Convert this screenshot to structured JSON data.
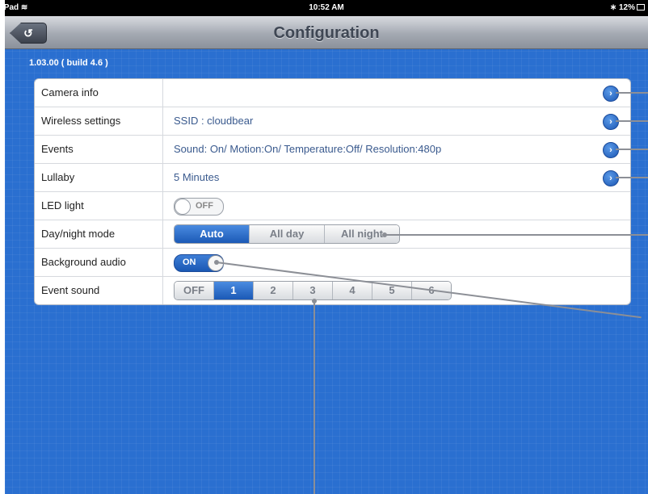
{
  "statusbar": {
    "device": "iPad",
    "wifi_icon": "wifi-icon",
    "time": "10:52 AM",
    "bluetooth_icon": "bluetooth-icon",
    "battery": "12%"
  },
  "navbar": {
    "back_icon": "back-arrow-icon",
    "back_glyph": "↺",
    "title": "Configuration"
  },
  "version": "1.03.00 ( build 4.6 )",
  "rows": [
    {
      "label": "Camera info",
      "value": ""
    },
    {
      "label": "Wireless settings",
      "value": "SSID : cloudbear"
    },
    {
      "label": "Events",
      "value": "Sound: On/ Motion:On/ Temperature:Off/ Resolution:480p"
    },
    {
      "label": "Lullaby",
      "value": "5 Minutes"
    },
    {
      "label": "LED light",
      "toggle": "OFF"
    },
    {
      "label": "Day/night mode",
      "segments": [
        "Auto",
        "All day",
        "All night"
      ],
      "selected": "Auto"
    },
    {
      "label": "Background audio",
      "toggle": "ON"
    },
    {
      "label": "Event sound",
      "segments": [
        "OFF",
        "1",
        "2",
        "3",
        "4",
        "5",
        "6"
      ],
      "selected": "1"
    }
  ],
  "disclosure_glyph": "›",
  "colors": {
    "background": "#2a6fd0",
    "accent": "#1b59b6",
    "value_text": "#3a5a8e"
  }
}
